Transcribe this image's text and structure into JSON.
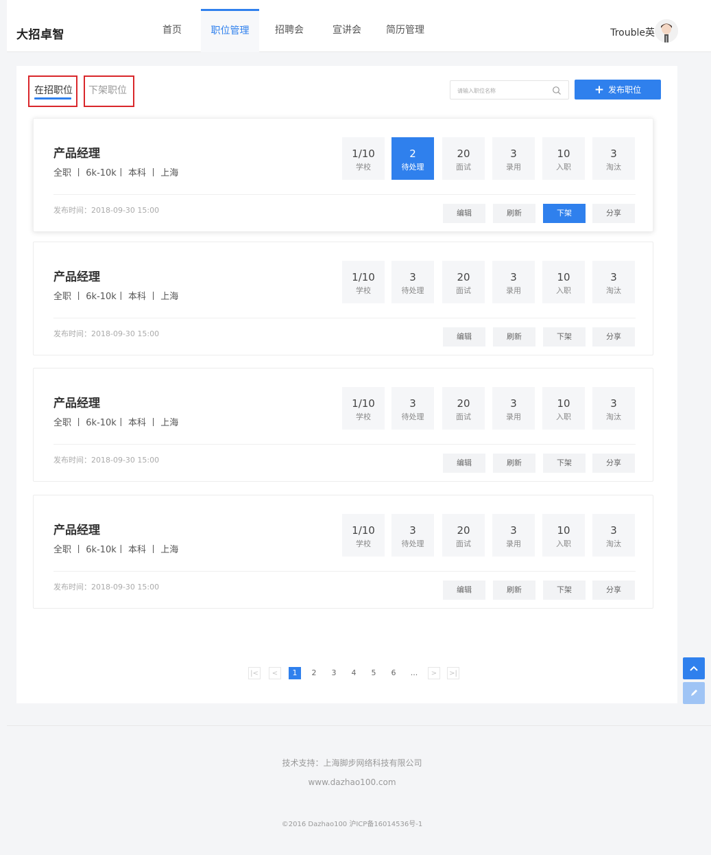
{
  "brand": {
    "name": "大招卓智"
  },
  "nav": {
    "items": [
      {
        "label": "首页",
        "active": false
      },
      {
        "label": "职位管理",
        "active": true
      },
      {
        "label": "招聘会",
        "active": false
      },
      {
        "label": "宣讲会",
        "active": false
      },
      {
        "label": "简历管理",
        "active": false
      }
    ]
  },
  "user": {
    "name": "Trouble英"
  },
  "tabs": {
    "active_label": "在招职位",
    "inactive_label": "下架职位"
  },
  "search": {
    "placeholder": "请输入职位名称",
    "icon": "search-icon"
  },
  "publish": {
    "label": "发布职位",
    "icon": "plus-icon"
  },
  "jobs": [
    {
      "title": "产品经理",
      "meta": "全职 丨 6k-10k丨 本科 丨 上海",
      "stats": [
        {
          "value": "1/10",
          "label": "学校"
        },
        {
          "value": "2",
          "label": "待处理"
        },
        {
          "value": "20",
          "label": "面试"
        },
        {
          "value": "3",
          "label": "录用"
        },
        {
          "value": "10",
          "label": "入职"
        },
        {
          "value": "3",
          "label": "淘汰"
        }
      ],
      "published": "发布时间：2018-09-30 15:00",
      "actions": [
        "编辑",
        "刷新",
        "下架",
        "分享"
      ]
    },
    {
      "title": "产品经理",
      "meta": "全职 丨 6k-10k丨 本科 丨 上海",
      "stats": [
        {
          "value": "1/10",
          "label": "学校"
        },
        {
          "value": "3",
          "label": "待处理"
        },
        {
          "value": "20",
          "label": "面试"
        },
        {
          "value": "3",
          "label": "录用"
        },
        {
          "value": "10",
          "label": "入职"
        },
        {
          "value": "3",
          "label": "淘汰"
        }
      ],
      "published": "发布时间：2018-09-30 15:00",
      "actions": [
        "编辑",
        "刷新",
        "下架",
        "分享"
      ]
    },
    {
      "title": "产品经理",
      "meta": "全职 丨 6k-10k丨 本科 丨 上海",
      "stats": [
        {
          "value": "1/10",
          "label": "学校"
        },
        {
          "value": "3",
          "label": "待处理"
        },
        {
          "value": "20",
          "label": "面试"
        },
        {
          "value": "3",
          "label": "录用"
        },
        {
          "value": "10",
          "label": "入职"
        },
        {
          "value": "3",
          "label": "淘汰"
        }
      ],
      "published": "发布时间：2018-09-30 15:00",
      "actions": [
        "编辑",
        "刷新",
        "下架",
        "分享"
      ]
    },
    {
      "title": "产品经理",
      "meta": "全职 丨 6k-10k丨 本科 丨 上海",
      "stats": [
        {
          "value": "1/10",
          "label": "学校"
        },
        {
          "value": "3",
          "label": "待处理"
        },
        {
          "value": "20",
          "label": "面试"
        },
        {
          "value": "3",
          "label": "录用"
        },
        {
          "value": "10",
          "label": "入职"
        },
        {
          "value": "3",
          "label": "淘汰"
        }
      ],
      "published": "发布时间：2018-09-30 15:00",
      "actions": [
        "编辑",
        "刷新",
        "下架",
        "分享"
      ]
    }
  ],
  "pagination": {
    "first": "|<",
    "prev": "<",
    "pages": [
      "1",
      "2",
      "3",
      "4",
      "5",
      "6"
    ],
    "current": "1",
    "ellipsis": "...",
    "next": ">",
    "last": ">|"
  },
  "floats": {
    "top_icon": "chevron-up-icon",
    "edit_icon": "pencil-icon"
  },
  "footer": {
    "support": "技术支持：上海脚步网络科技有限公司",
    "website": "www.dazhao100.com",
    "copyright": "©2016 Dazhao100 沪ICP备16014536号-1"
  },
  "colors": {
    "accent": "#2f80ed",
    "annotation_red": "#d9262a"
  }
}
